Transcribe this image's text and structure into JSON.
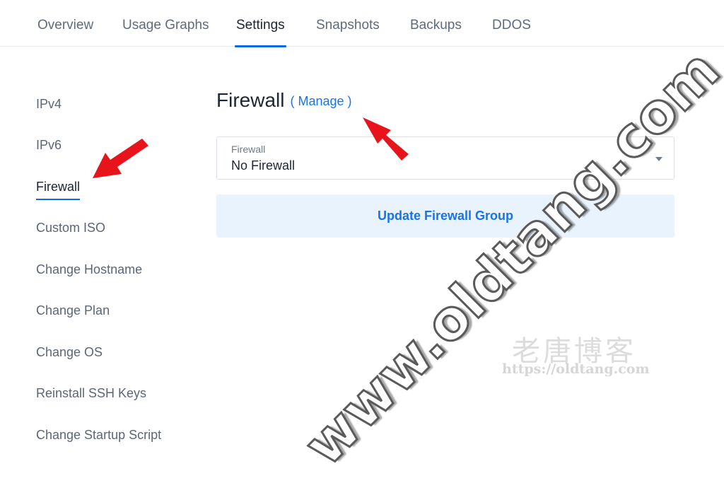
{
  "tabs": [
    {
      "label": "Overview",
      "active": false
    },
    {
      "label": "Usage Graphs",
      "active": false
    },
    {
      "label": "Settings",
      "active": true
    },
    {
      "label": "Snapshots",
      "active": false
    },
    {
      "label": "Backups",
      "active": false
    },
    {
      "label": "DDOS",
      "active": false
    }
  ],
  "sidenav": [
    {
      "label": "IPv4",
      "active": false
    },
    {
      "label": "IPv6",
      "active": false
    },
    {
      "label": "Firewall",
      "active": true
    },
    {
      "label": "Custom ISO",
      "active": false
    },
    {
      "label": "Change Hostname",
      "active": false
    },
    {
      "label": "Change Plan",
      "active": false
    },
    {
      "label": "Change OS",
      "active": false
    },
    {
      "label": "Reinstall SSH Keys",
      "active": false
    },
    {
      "label": "Change Startup Script",
      "active": false
    }
  ],
  "main": {
    "title": "Firewall",
    "manage_link": "( Manage )",
    "firewall_select": {
      "label": "Firewall",
      "value": "No Firewall"
    },
    "update_button": "Update Firewall Group"
  },
  "watermark": {
    "main": "www.oldtang.com",
    "cn": "老唐博客",
    "url": "https://oldtang.com"
  },
  "colors": {
    "accent": "#1a73e8",
    "tab_underline": "#0b6be5",
    "button_bg": "#e9f3fe",
    "arrow": "#e8141c"
  }
}
